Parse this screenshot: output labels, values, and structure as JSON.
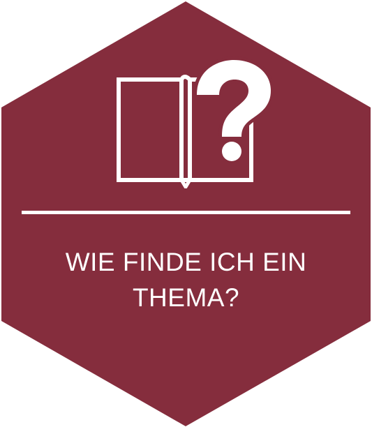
{
  "tile": {
    "background_color": "#852d3d",
    "foreground_color": "#ffffff",
    "icon": "book-question-icon",
    "title_line_1": "WIE FINDE ICH EIN",
    "title_line_2": "THEMA?"
  }
}
